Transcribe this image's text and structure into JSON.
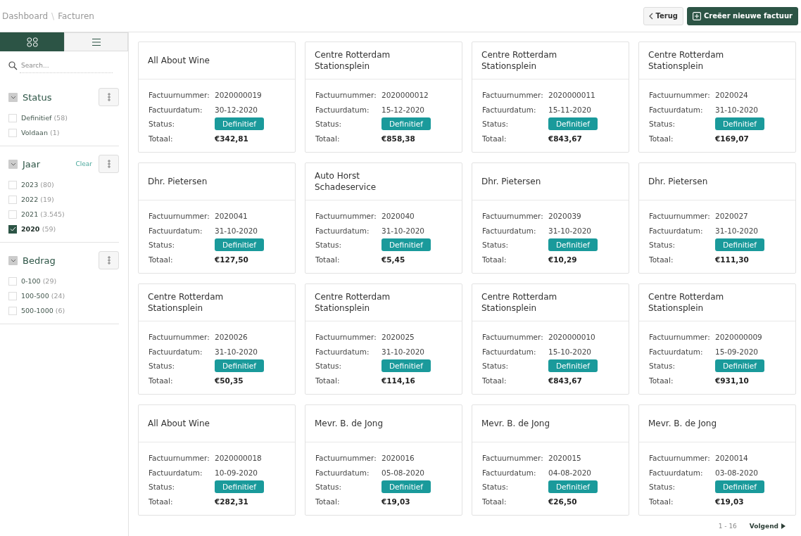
{
  "breadcrumb": [
    "Dashboard",
    "Facturen"
  ],
  "breadcrumb_separator": "\\",
  "actions": {
    "back": "Terug",
    "create": "Creëer nieuwe factuur"
  },
  "view_toggle": [
    {
      "kind": "grid",
      "selected": true
    },
    {
      "kind": "list",
      "selected": false
    }
  ],
  "search": {
    "placeholder": "Search..."
  },
  "filters": [
    {
      "title": "Status",
      "expanded": true,
      "options": [
        {
          "label": "Definitief",
          "count": "(58)",
          "checked": false
        },
        {
          "label": "Voldaan",
          "count": "(1)",
          "checked": false
        }
      ]
    },
    {
      "title": "Jaar",
      "expanded": true,
      "clear": "Clear",
      "options": [
        {
          "label": "2023",
          "count": "(80)",
          "checked": false
        },
        {
          "label": "2022",
          "count": "(19)",
          "checked": false
        },
        {
          "label": "2021",
          "count": "(3.545)",
          "checked": false
        },
        {
          "label": "2020",
          "count": "(59)",
          "checked": true
        }
      ]
    },
    {
      "title": "Bedrag",
      "expanded": true,
      "options": [
        {
          "label": "0-100",
          "count": "(29)",
          "checked": false
        },
        {
          "label": "100-500",
          "count": "(24)",
          "checked": false
        },
        {
          "label": "500-1000",
          "count": "(6)",
          "checked": false
        }
      ]
    }
  ],
  "invoices": [
    {
      "name": "All About Wine",
      "fields": [
        {
          "kind": "text",
          "label": "Factuurnummer:",
          "value": "2020000019"
        },
        {
          "kind": "text",
          "label": "Factuurdatum:",
          "value": "30-12-2020"
        },
        {
          "kind": "badge",
          "label": "Status:",
          "value": "Definitief"
        },
        {
          "kind": "amount",
          "label": "Totaal:",
          "value": "€342,81"
        }
      ]
    },
    {
      "name": "Centre Rotterdam Stationsplein",
      "fields": [
        {
          "kind": "text",
          "label": "Factuurnummer:",
          "value": "2020000012"
        },
        {
          "kind": "text",
          "label": "Factuurdatum:",
          "value": "15-12-2020"
        },
        {
          "kind": "badge",
          "label": "Status:",
          "value": "Definitief"
        },
        {
          "kind": "amount",
          "label": "Totaal:",
          "value": "€858,38"
        }
      ]
    },
    {
      "name": "Centre Rotterdam Stationsplein",
      "fields": [
        {
          "kind": "text",
          "label": "Factuurnummer:",
          "value": "2020000011"
        },
        {
          "kind": "text",
          "label": "Factuurdatum:",
          "value": "15-11-2020"
        },
        {
          "kind": "badge",
          "label": "Status:",
          "value": "Definitief"
        },
        {
          "kind": "amount",
          "label": "Totaal:",
          "value": "€843,67"
        }
      ]
    },
    {
      "name": "Centre Rotterdam Stationsplein",
      "fields": [
        {
          "kind": "text",
          "label": "Factuurnummer:",
          "value": "2020024"
        },
        {
          "kind": "text",
          "label": "Factuurdatum:",
          "value": "31-10-2020"
        },
        {
          "kind": "badge",
          "label": "Status:",
          "value": "Definitief"
        },
        {
          "kind": "amount",
          "label": "Totaal:",
          "value": "€169,07"
        }
      ]
    },
    {
      "name": "Dhr. Pietersen",
      "fields": [
        {
          "kind": "text",
          "label": "Factuurnummer:",
          "value": "2020041"
        },
        {
          "kind": "text",
          "label": "Factuurdatum:",
          "value": "31-10-2020"
        },
        {
          "kind": "badge",
          "label": "Status:",
          "value": "Definitief"
        },
        {
          "kind": "amount",
          "label": "Totaal:",
          "value": "€127,50"
        }
      ]
    },
    {
      "name": "Auto Horst Schadeservice",
      "fields": [
        {
          "kind": "text",
          "label": "Factuurnummer:",
          "value": "2020040"
        },
        {
          "kind": "text",
          "label": "Factuurdatum:",
          "value": "31-10-2020"
        },
        {
          "kind": "badge",
          "label": "Status:",
          "value": "Definitief"
        },
        {
          "kind": "amount",
          "label": "Totaal:",
          "value": "€5,45"
        }
      ]
    },
    {
      "name": "Dhr. Pietersen",
      "fields": [
        {
          "kind": "text",
          "label": "Factuurnummer:",
          "value": "2020039"
        },
        {
          "kind": "text",
          "label": "Factuurdatum:",
          "value": "31-10-2020"
        },
        {
          "kind": "badge",
          "label": "Status:",
          "value": "Definitief"
        },
        {
          "kind": "amount",
          "label": "Totaal:",
          "value": "€10,29"
        }
      ]
    },
    {
      "name": "Dhr. Pietersen",
      "fields": [
        {
          "kind": "text",
          "label": "Factuurnummer:",
          "value": "2020027"
        },
        {
          "kind": "text",
          "label": "Factuurdatum:",
          "value": "31-10-2020"
        },
        {
          "kind": "badge",
          "label": "Status:",
          "value": "Definitief"
        },
        {
          "kind": "amount",
          "label": "Totaal:",
          "value": "€111,30"
        }
      ]
    },
    {
      "name": "Centre Rotterdam Stationsplein",
      "fields": [
        {
          "kind": "text",
          "label": "Factuurnummer:",
          "value": "2020026"
        },
        {
          "kind": "text",
          "label": "Factuurdatum:",
          "value": "31-10-2020"
        },
        {
          "kind": "badge",
          "label": "Status:",
          "value": "Definitief"
        },
        {
          "kind": "amount",
          "label": "Totaal:",
          "value": "€50,35"
        }
      ]
    },
    {
      "name": "Centre Rotterdam Stationsplein",
      "fields": [
        {
          "kind": "text",
          "label": "Factuurnummer:",
          "value": "2020025"
        },
        {
          "kind": "text",
          "label": "Factuurdatum:",
          "value": "31-10-2020"
        },
        {
          "kind": "badge",
          "label": "Status:",
          "value": "Definitief"
        },
        {
          "kind": "amount",
          "label": "Totaal:",
          "value": "€114,16"
        }
      ]
    },
    {
      "name": "Centre Rotterdam Stationsplein",
      "fields": [
        {
          "kind": "text",
          "label": "Factuurnummer:",
          "value": "2020000010"
        },
        {
          "kind": "text",
          "label": "Factuurdatum:",
          "value": "15-10-2020"
        },
        {
          "kind": "badge",
          "label": "Status:",
          "value": "Definitief"
        },
        {
          "kind": "amount",
          "label": "Totaal:",
          "value": "€843,67"
        }
      ]
    },
    {
      "name": "Centre Rotterdam Stationsplein",
      "fields": [
        {
          "kind": "text",
          "label": "Factuurnummer:",
          "value": "2020000009"
        },
        {
          "kind": "text",
          "label": "Factuurdatum:",
          "value": "15-09-2020"
        },
        {
          "kind": "badge",
          "label": "Status:",
          "value": "Definitief"
        },
        {
          "kind": "amount",
          "label": "Totaal:",
          "value": "€931,10"
        }
      ]
    },
    {
      "name": "All About Wine",
      "fields": [
        {
          "kind": "text",
          "label": "Factuurnummer:",
          "value": "2020000018"
        },
        {
          "kind": "text",
          "label": "Factuurdatum:",
          "value": "10-09-2020"
        },
        {
          "kind": "badge",
          "label": "Status:",
          "value": "Definitief"
        },
        {
          "kind": "amount",
          "label": "Totaal:",
          "value": "€282,31"
        }
      ]
    },
    {
      "name": "Mevr. B. de Jong",
      "fields": [
        {
          "kind": "text",
          "label": "Factuurnummer:",
          "value": "2020016"
        },
        {
          "kind": "text",
          "label": "Factuurdatum:",
          "value": "05-08-2020"
        },
        {
          "kind": "badge",
          "label": "Status:",
          "value": "Definitief"
        },
        {
          "kind": "amount",
          "label": "Totaal:",
          "value": "€19,03"
        }
      ]
    },
    {
      "name": "Mevr. B. de Jong",
      "fields": [
        {
          "kind": "text",
          "label": "Factuurnummer:",
          "value": "2020015"
        },
        {
          "kind": "text",
          "label": "Factuurdatum:",
          "value": "04-08-2020"
        },
        {
          "kind": "badge",
          "label": "Status:",
          "value": "Definitief"
        },
        {
          "kind": "amount",
          "label": "Totaal:",
          "value": "€26,50"
        }
      ]
    },
    {
      "name": "Mevr. B. de Jong",
      "fields": [
        {
          "kind": "text",
          "label": "Factuurnummer:",
          "value": "2020014"
        },
        {
          "kind": "text",
          "label": "Factuurdatum:",
          "value": "03-08-2020"
        },
        {
          "kind": "badge",
          "label": "Status:",
          "value": "Definitief"
        },
        {
          "kind": "amount",
          "label": "Totaal:",
          "value": "€19,03"
        }
      ]
    }
  ],
  "pagination": {
    "range": "1 - 16",
    "next": "Volgend"
  }
}
